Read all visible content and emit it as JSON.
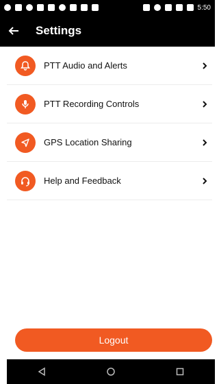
{
  "status_bar": {
    "time": "5:50",
    "left_icons": [
      "camera-icon",
      "message-icon",
      "voicemail-icon",
      "accessibility-icon",
      "image-icon",
      "chrome-icon",
      "app-icon",
      "photo-icon",
      "battery-saver-icon"
    ],
    "right_icons": [
      "bluetooth-icon",
      "do-not-disturb-icon",
      "wifi-icon",
      "signal-icon",
      "battery-icon"
    ]
  },
  "header": {
    "title": "Settings",
    "back_icon": "arrow-left-icon"
  },
  "settings": {
    "items": [
      {
        "label": "PTT Audio and Alerts",
        "icon": "bell-icon"
      },
      {
        "label": "PTT Recording Controls",
        "icon": "microphone-icon"
      },
      {
        "label": "GPS Location Sharing",
        "icon": "location-arrow-icon"
      },
      {
        "label": "Help and Feedback",
        "icon": "headset-icon"
      }
    ]
  },
  "footer": {
    "logout_label": "Logout"
  },
  "colors": {
    "accent": "#f15a22",
    "bar_background": "#000000"
  }
}
